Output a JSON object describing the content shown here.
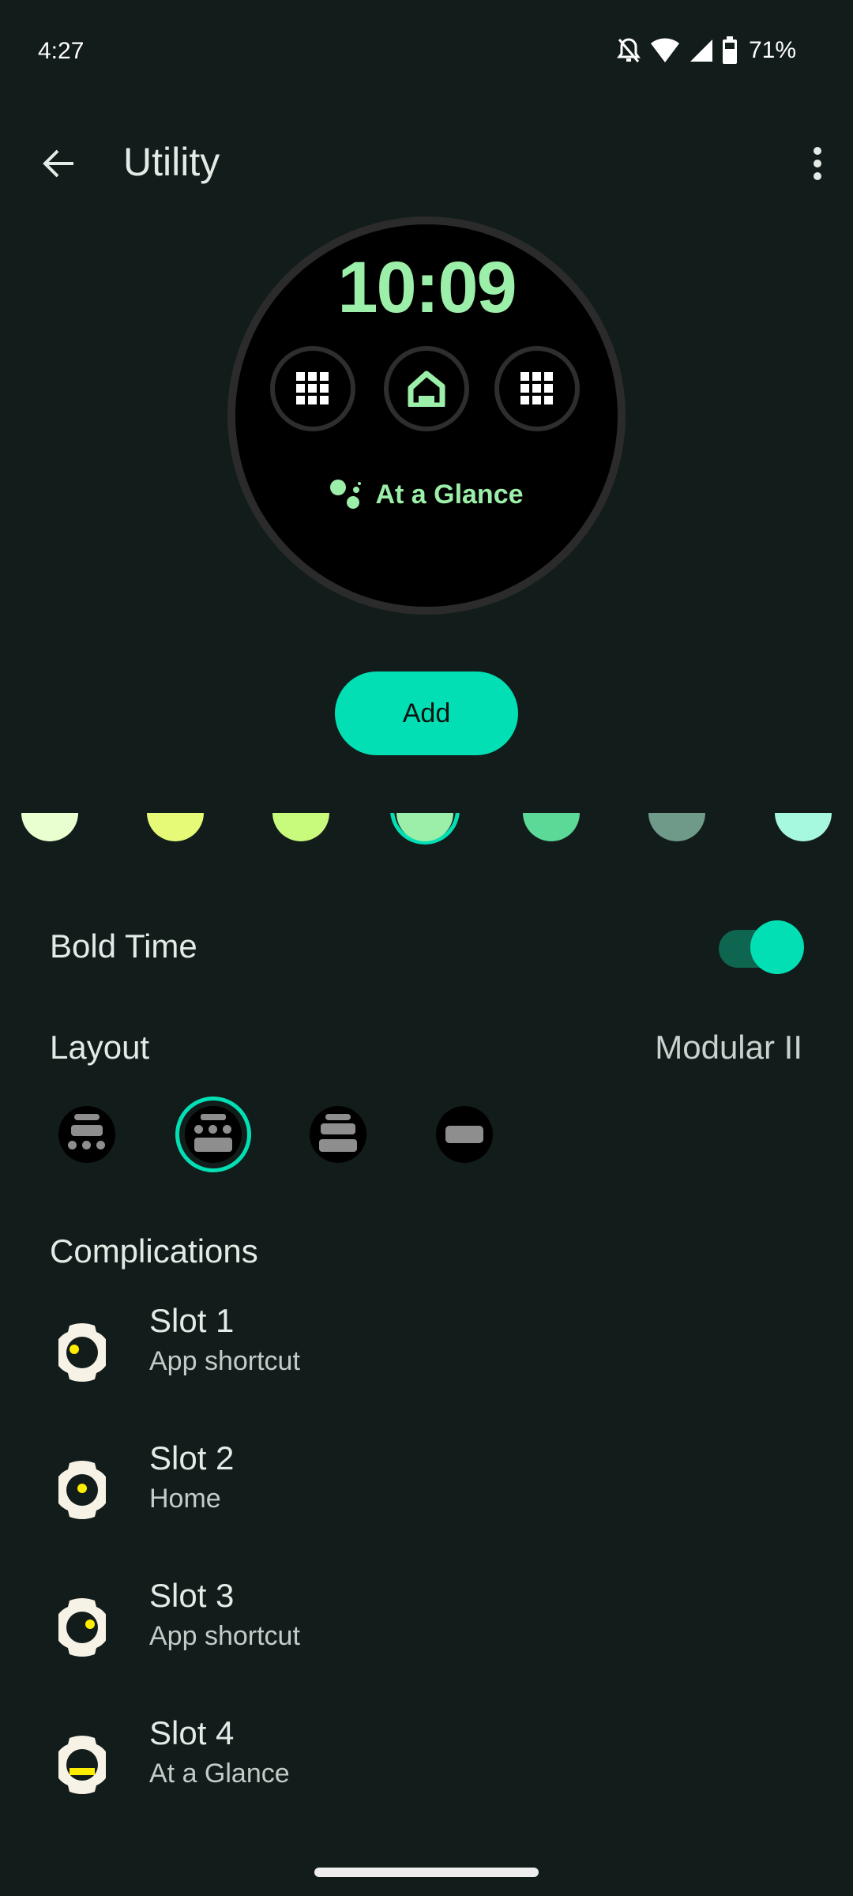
{
  "status_bar": {
    "time": "4:27",
    "icons": [
      "notifications-off-icon",
      "wifi-icon",
      "cell-signal-icon",
      "battery-icon"
    ],
    "battery_percent": "71%"
  },
  "app_bar": {
    "back_icon": "arrow-back-icon",
    "title": "Utility",
    "more_icon": "more-vert-icon"
  },
  "watch_preview": {
    "time": "10:09",
    "complications": [
      {
        "icon": "apps-grid-icon"
      },
      {
        "icon": "home-icon"
      },
      {
        "icon": "apps-grid-icon"
      }
    ],
    "glance_icon": "assistant-dots-icon",
    "glance_text": "At a Glance",
    "accent_color": "#9cefa8"
  },
  "add_button": {
    "label": "Add",
    "color": "#03dfb4"
  },
  "color_swatches": {
    "selected_index": 3,
    "colors": [
      "#eaffd0",
      "#e6fa78",
      "#c8fb7c",
      "#9cefa8",
      "#5cd897",
      "#6f9a8a",
      "#a6f8de"
    ]
  },
  "bold_time": {
    "label": "Bold Time",
    "enabled": true
  },
  "layout": {
    "label": "Layout",
    "value": "Modular II",
    "selected_index": 1,
    "options": [
      "layout-option-1",
      "layout-option-modular-ii",
      "layout-option-3",
      "layout-option-4"
    ]
  },
  "complications": {
    "header": "Complications",
    "slots": [
      {
        "title": "Slot 1",
        "subtitle": "App shortcut"
      },
      {
        "title": "Slot 2",
        "subtitle": "Home"
      },
      {
        "title": "Slot 3",
        "subtitle": "App shortcut"
      },
      {
        "title": "Slot 4",
        "subtitle": "At a Glance"
      }
    ]
  }
}
